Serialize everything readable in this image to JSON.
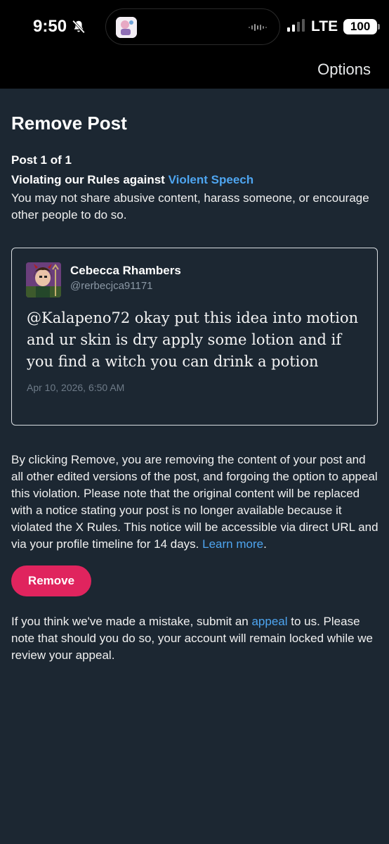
{
  "status_bar": {
    "time": "9:50",
    "network": "LTE",
    "battery": "100"
  },
  "header": {
    "options_label": "Options"
  },
  "page": {
    "title": "Remove Post",
    "post_count": "Post 1 of 1",
    "rule_prefix": "Violating our Rules against ",
    "rule_link": "Violent Speech",
    "rule_description": "You may not share abusive content, harass someone, or encourage other people to do so."
  },
  "post": {
    "author_name": "Cebecca Rhambers",
    "author_handle": "@rerbecjca91171",
    "text": "@Kalapeno72 okay put this idea into motion and ur skin is dry apply some lotion and if you find a witch you can drink a potion",
    "date": "Apr 10, 2026, 6:50 AM"
  },
  "notice": {
    "text": "By clicking Remove, you are removing the content of your post and all other edited versions of the post, and forgoing the option to appeal this violation. Please note that the original content will be replaced with a notice stating your post is no longer available because it violated the X Rules. This notice will be accessible via direct URL and via your profile timeline for 14 days. ",
    "learn_more": "Learn more",
    "period": "."
  },
  "actions": {
    "remove_label": "Remove"
  },
  "appeal": {
    "prefix": "If you think we've made a mistake, submit an ",
    "link": "appeal",
    "suffix": " to us. Please note that should you do so, your account will remain locked while we review your appeal."
  },
  "colors": {
    "background": "#1c2732",
    "link": "#4ea5f0",
    "remove_button": "#e0245e",
    "top_bar": "#000000"
  },
  "icons": [
    "bell-slash-icon",
    "app-icon",
    "audio-wave-icon",
    "cellular-signal-icon",
    "battery-icon"
  ]
}
